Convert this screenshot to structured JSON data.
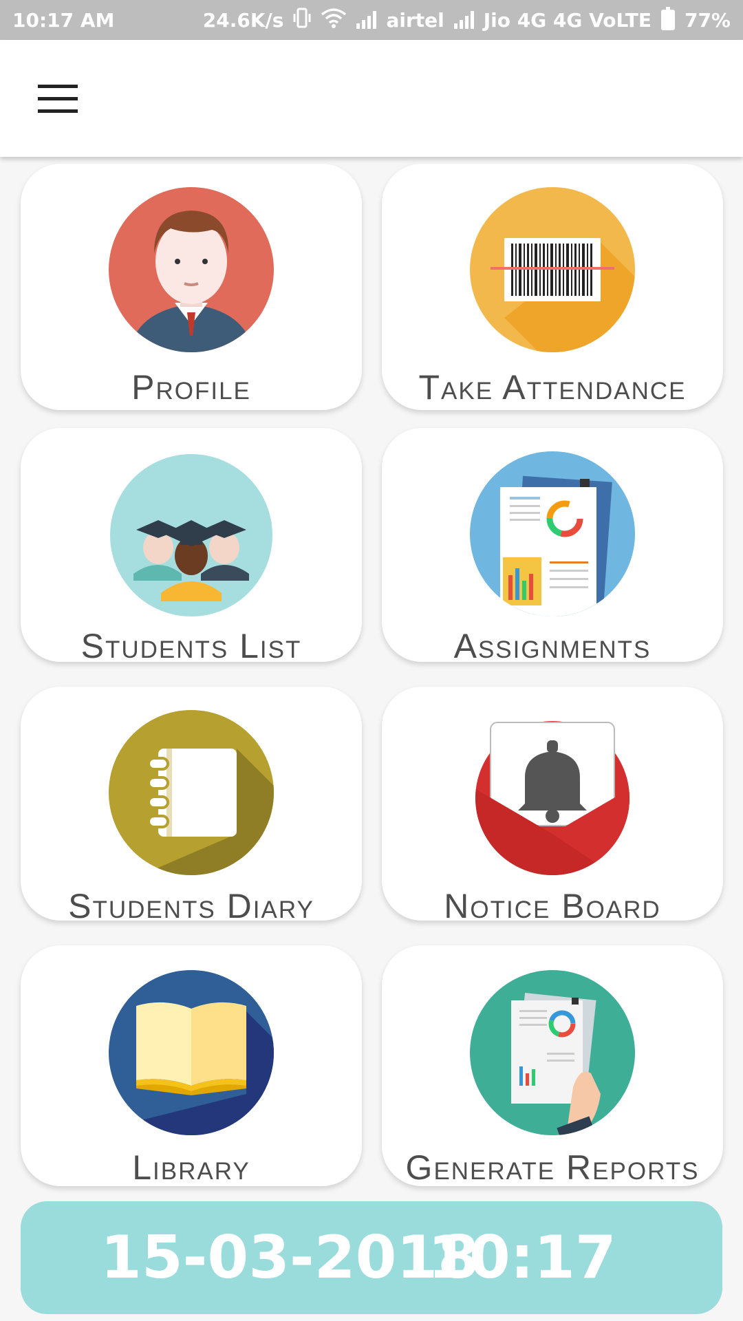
{
  "status_bar": {
    "time": "10:17 AM",
    "speed": "24.6K/s",
    "carrier1": "airtel",
    "carrier2": "Jio 4G 4G VoLTE",
    "battery": "77%"
  },
  "app_bar": {
    "menu_icon": "hamburger-menu-icon"
  },
  "tiles": [
    {
      "label": "Profile",
      "icon": "profile-icon"
    },
    {
      "label": "Take Attendance",
      "icon": "barcode-icon"
    },
    {
      "label": "Students List",
      "icon": "students-icon"
    },
    {
      "label": "Assignments",
      "icon": "assignments-icon"
    },
    {
      "label": "Students Diary",
      "icon": "diary-icon"
    },
    {
      "label": "Notice Board",
      "icon": "bell-icon"
    },
    {
      "label": "Library",
      "icon": "book-icon"
    },
    {
      "label": "Generate Reports",
      "icon": "reports-icon"
    }
  ],
  "footer": {
    "date": "15-03-2018",
    "time": "10:17"
  },
  "colors": {
    "profile": "#e06b5b",
    "attendance": "#f2b84b",
    "students": "#a6dddf",
    "assignments": "#6fb6e0",
    "diary": "#b6a02f",
    "notice": "#d32f2f",
    "library": "#2f5f96",
    "reports": "#3eae96",
    "datebar": "#9adcdb"
  }
}
